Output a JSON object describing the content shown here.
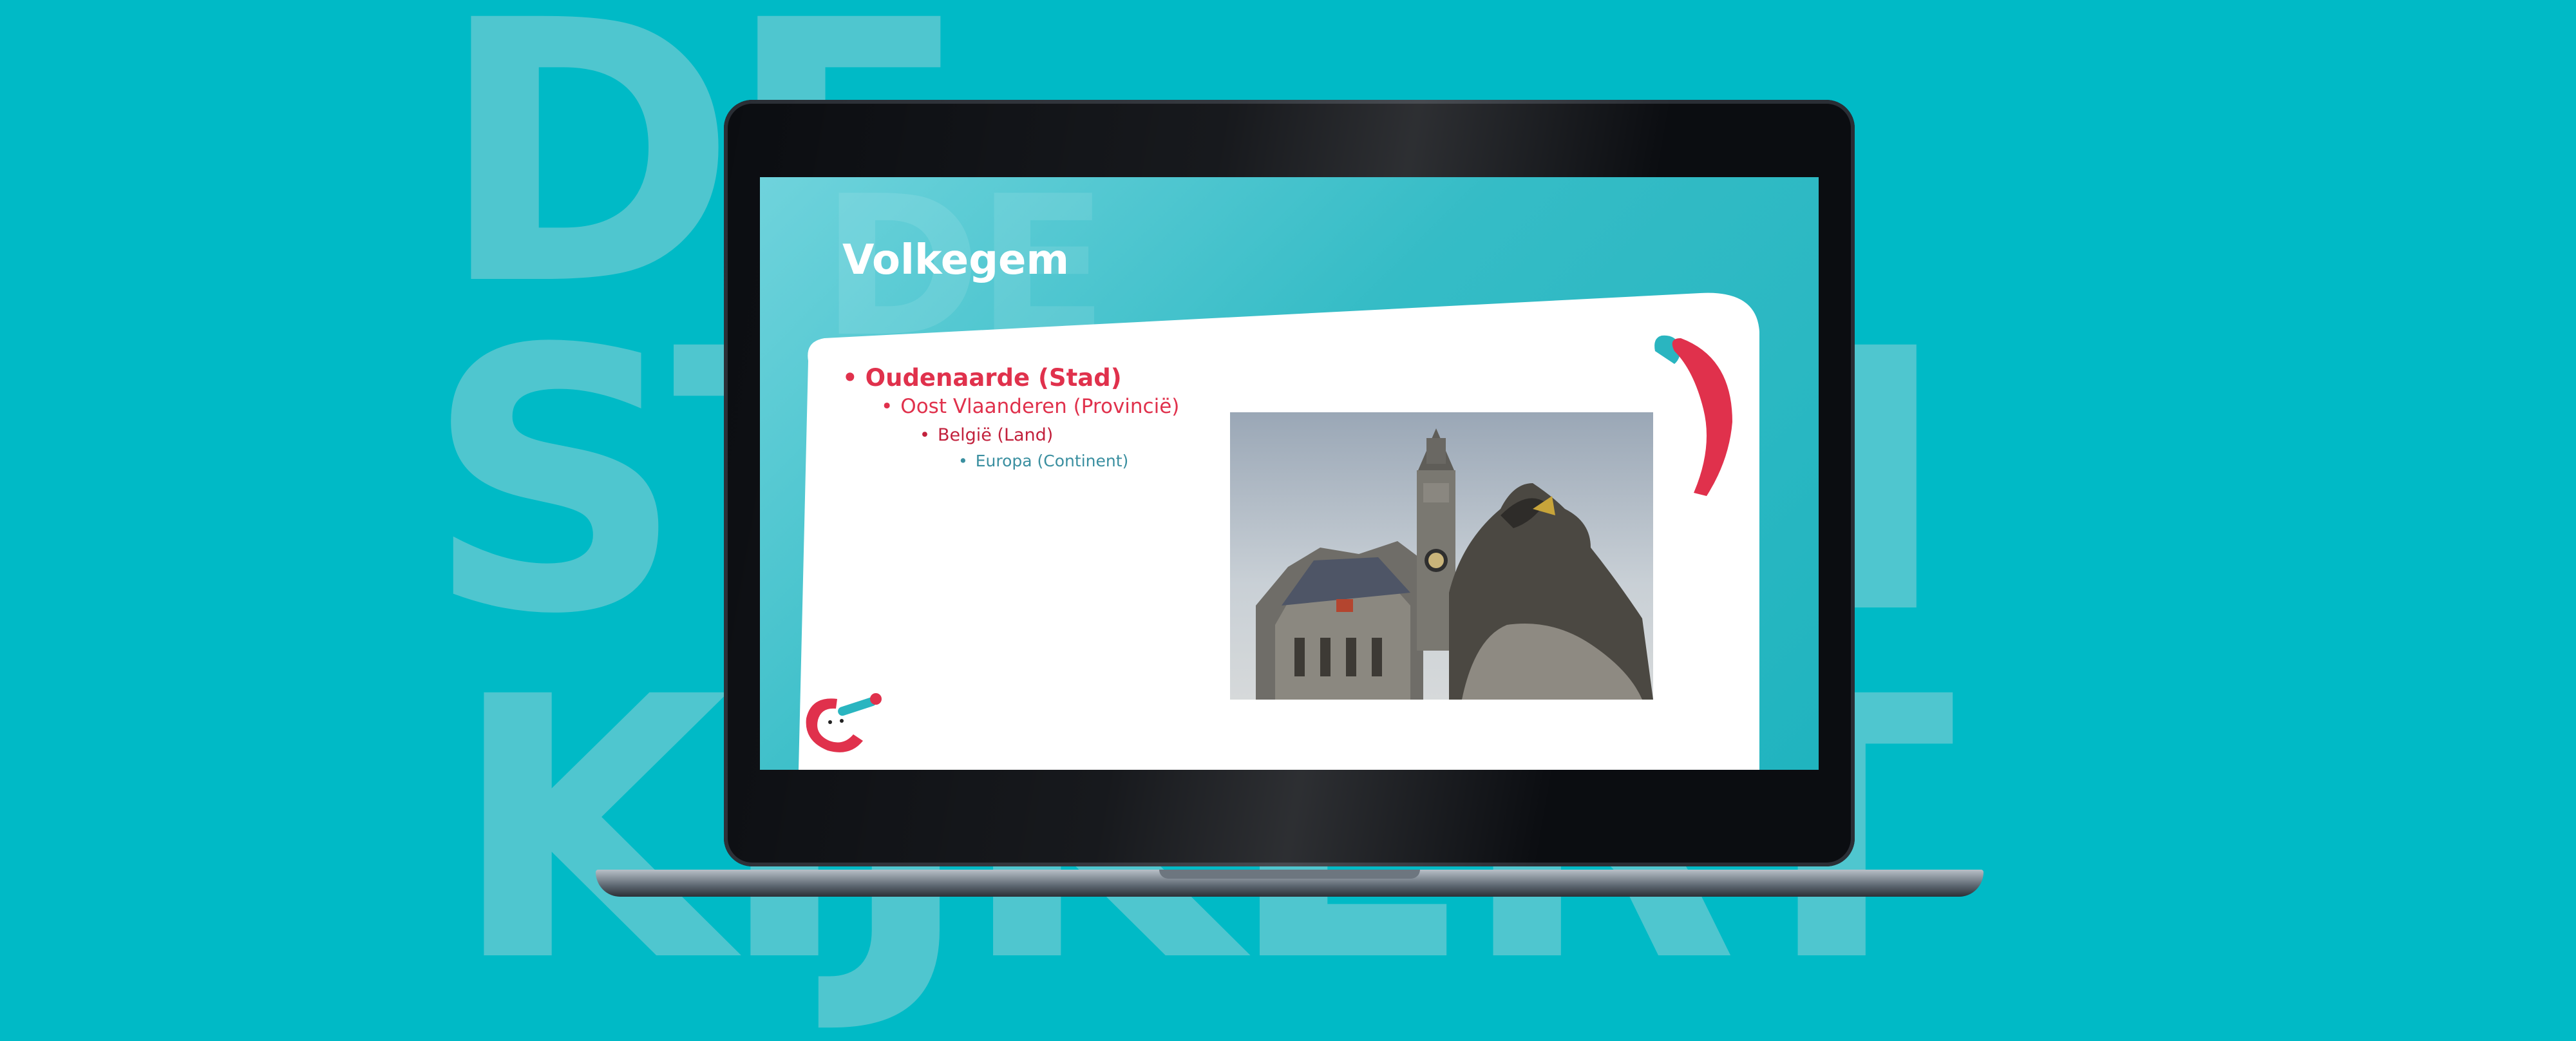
{
  "background_text": {
    "row1": "DE",
    "row2": "STIJKEN",
    "row3": "KIJKERT"
  },
  "slide": {
    "title": "Volkegem",
    "watermark": "DE",
    "bullets": [
      {
        "level": 1,
        "text": "Oudenaarde (Stad)"
      },
      {
        "level": 2,
        "text": "Oost Vlaanderen (Provincië)"
      },
      {
        "level": 3,
        "text": "België (Land)"
      },
      {
        "level": 4,
        "text": "Europa (Continent)"
      }
    ],
    "bullet_glyph": "•",
    "photo_icon": "town-hall-photo",
    "logo_icon": "kijkert-logo-icon",
    "swoosh_icon": "red-swoosh-icon"
  },
  "colors": {
    "background": "#00BAC6",
    "accent_red": "#E0314C",
    "text_teal": "#3A8FA0",
    "laptop_frame": "#0b0d11"
  }
}
